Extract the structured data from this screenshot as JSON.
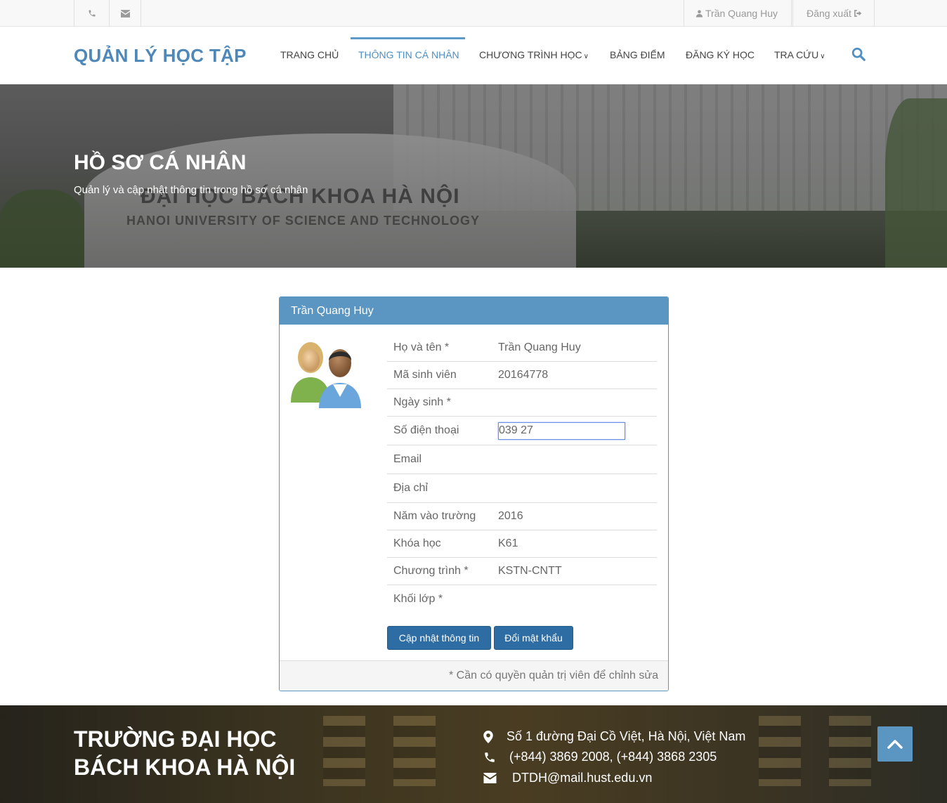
{
  "topbar": {
    "user_name": "Trần Quang Huy",
    "logout_label": "Đăng xuất"
  },
  "nav": {
    "brand": "QUẢN LÝ HỌC TẬP",
    "items": [
      {
        "label": "TRANG CHỦ"
      },
      {
        "label": "THÔNG TIN CÁ NHÂN"
      },
      {
        "label": "CHƯƠNG TRÌNH HỌC"
      },
      {
        "label": "BẢNG ĐIỂM"
      },
      {
        "label": "ĐĂNG KÝ HỌC"
      },
      {
        "label": "TRA CỨU"
      }
    ],
    "active_index": 1
  },
  "hero": {
    "title": "HỒ SƠ CÁ NHÂN",
    "subtitle": "Quản lý và cập nhật thông tin trong hồ sơ cá nhân",
    "rock_line1": "ĐẠI HỌC BÁCH KHOA HÀ NỘI",
    "rock_line2": "HANOI UNIVERSITY OF SCIENCE AND TECHNOLOGY"
  },
  "panel": {
    "header": "Trần Quang Huy",
    "fields": [
      {
        "label": "Họ và tên *",
        "value": "Trần Quang Huy"
      },
      {
        "label": "Mã sinh viên",
        "value": "20164778"
      },
      {
        "label": "Ngày sinh *",
        "value": ""
      },
      {
        "label": "Số điện thoại",
        "value": "039 27"
      },
      {
        "label": "Email",
        "value": ""
      },
      {
        "label": "Địa chỉ",
        "value": ""
      },
      {
        "label": "Năm vào trường",
        "value": "2016"
      },
      {
        "label": "Khóa học",
        "value": "K61"
      },
      {
        "label": "Chương trình *",
        "value": "KSTN-CNTT"
      },
      {
        "label": "Khối lớp *",
        "value": ""
      }
    ],
    "update_button": "Cập nhật thông tin",
    "password_button": "Đổi mật khẩu",
    "footer_note": "* Cần có quyền quản trị viên để chỉnh sửa"
  },
  "footer": {
    "title_line1": "TRƯỜNG ĐẠI HỌC",
    "title_line2": "BÁCH KHOA HÀ NỘI",
    "address": "Số 1 đường Đại Cồ Việt, Hà Nội, Việt Nam",
    "phone": "(+844) 3869 2008, (+844) 3868 2305",
    "email": "DTDH@mail.hust.edu.vn"
  },
  "colors": {
    "accent": "#5b95c2",
    "brand": "#4d88b8",
    "button": "#2e6da4"
  }
}
